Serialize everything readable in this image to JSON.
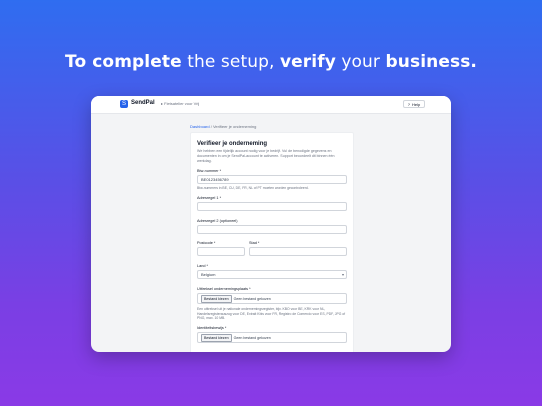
{
  "headline": {
    "part1": "To complete",
    "part2": " the setup, ",
    "part3": "verify",
    "part4": " your ",
    "part5": "business."
  },
  "app": {
    "logo_mark": "S",
    "name": "SendPal",
    "account": "▸ Fietsatelier voor Vrij",
    "help_label": "Help",
    "help_icon": "help-icon"
  },
  "breadcrumb": {
    "root": "Dashboard",
    "sep": "/",
    "current": "Verifieer je onderneming"
  },
  "form": {
    "title": "Verifieer je onderneming",
    "description": "We hebben een tijdelijk account nodig voor je bedrijf. Vul de benodigde gegevens en documenten in om je SendPal-account te activeren. Support beoordeelt dit binnen één werkdag.",
    "vat_label": "Btw-nummer *",
    "vat_value": "BE0123456789",
    "vat_hint": "Btw-nummers in BE, CU, DE, FR, NL of PT moeten worden gecontroleerd.",
    "address1_label": "Adresregel 1 *",
    "address1_value": "",
    "address2_label": "Adresregel 2 (optioneel)",
    "address2_value": "",
    "postcode_label": "Postcode *",
    "postcode_value": "",
    "city_label": "Stad *",
    "city_value": "",
    "country_label": "Land *",
    "country_value": "Belgium",
    "extract_label": "Uittreksel ondernemingsplaats *",
    "extract_btn": "Bestand kiezen",
    "extract_status": "Geen bestand gekozen",
    "extract_hint": "Een uittreksel uit je nationale ondernemingsregister, bijv. KBO voor BE, KRK voor NL, Handelsregisterauszug voor DE, Extrait Kbis voor FR, Registro de Comercio voor ES, PDF, JPG of PNG, max. 10 MB.",
    "id_label": "Identiteitsbewijs *",
    "id_btn": "Bestand kiezen",
    "id_status": "Geen bestand gekozen"
  }
}
